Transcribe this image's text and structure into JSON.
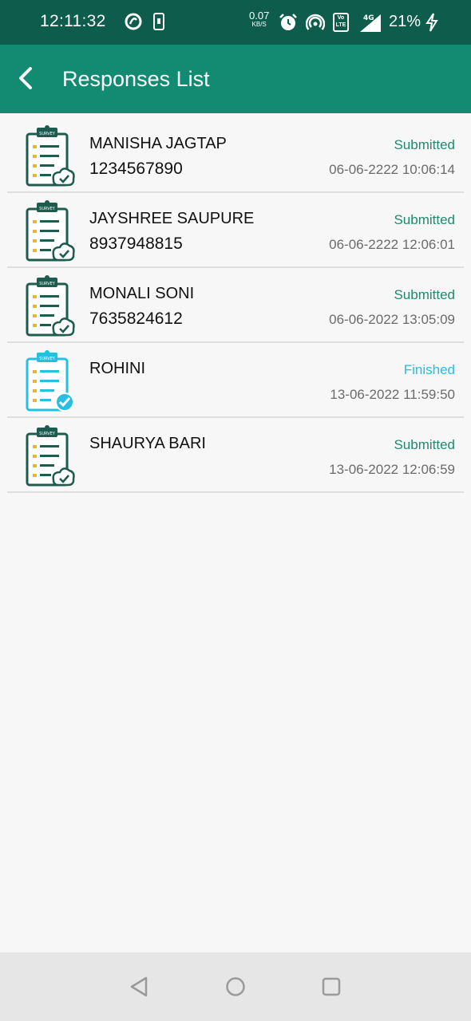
{
  "status_bar": {
    "time": "12:11:32",
    "speed_value": "0.07",
    "speed_unit": "KB/S",
    "volte_label": "Vo LTE",
    "network": "4G",
    "battery": "21%"
  },
  "app_bar": {
    "title": "Responses List"
  },
  "colors": {
    "status_bar": "#0d5c4c",
    "app_bar": "#138a72",
    "submitted": "#1f8a6e",
    "finished": "#26bfe0"
  },
  "responses": [
    {
      "name": "MANISHA JAGTAP",
      "phone": "1234567890",
      "status": "Submitted",
      "datetime": "06-06-2222 10:06:14",
      "icon": "survey-clipboard-cloud-icon"
    },
    {
      "name": "JAYSHREE SAUPURE",
      "phone": "8937948815",
      "status": "Submitted",
      "datetime": "06-06-2222 12:06:01",
      "icon": "survey-clipboard-cloud-icon"
    },
    {
      "name": "MONALI SONI",
      "phone": "7635824612",
      "status": "Submitted",
      "datetime": "06-06-2022 13:05:09",
      "icon": "survey-clipboard-cloud-icon"
    },
    {
      "name": "ROHINI",
      "phone": "",
      "status": "Finished",
      "datetime": "13-06-2022 11:59:50",
      "icon": "survey-clipboard-check-icon"
    },
    {
      "name": "SHAURYA BARI",
      "phone": "",
      "status": "Submitted",
      "datetime": "13-06-2022 12:06:59",
      "icon": "survey-clipboard-cloud-icon"
    }
  ],
  "icon_label": "SURVEY"
}
